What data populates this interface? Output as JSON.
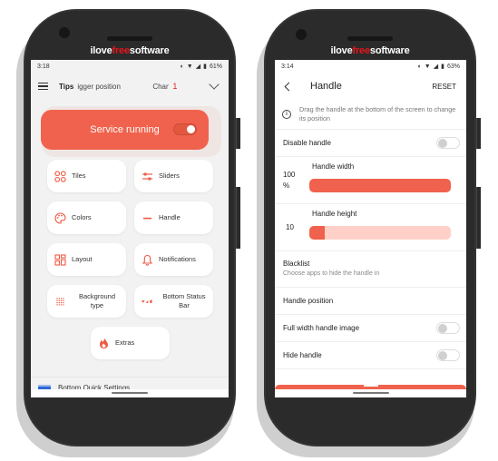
{
  "brand": {
    "prefix": "ilove",
    "highlight": "free",
    "suffix": "software"
  },
  "left_phone": {
    "status": {
      "time": "3:18",
      "battery": "61%"
    },
    "toolbar": {
      "tips_label": "Tips",
      "tip_text": "igger position",
      "chan_text": "Chan",
      "badge_count": "1"
    },
    "service": {
      "label": "Service running",
      "enabled": true
    },
    "tiles": [
      {
        "label": "Tiles",
        "icon": "tiles-icon"
      },
      {
        "label": "Sliders",
        "icon": "sliders-icon"
      },
      {
        "label": "Colors",
        "icon": "palette-icon"
      },
      {
        "label": "Handle",
        "icon": "handle-icon"
      },
      {
        "label": "Layout",
        "icon": "layout-icon"
      },
      {
        "label": "Notifications",
        "icon": "bell-icon"
      },
      {
        "label": "Background type",
        "icon": "background-pattern-icon"
      },
      {
        "label": "Bottom Status Bar",
        "icon": "status-bar-icon"
      },
      {
        "label": "Extras",
        "icon": "fire-icon"
      }
    ],
    "bottom_item": {
      "label": "Bottom Quick Settings"
    }
  },
  "right_phone": {
    "status": {
      "time": "3:14",
      "battery": "63%"
    },
    "toolbar": {
      "title": "Handle",
      "reset_label": "RESET"
    },
    "info_text": "Drag the handle at the bottom of the screen to change its position",
    "disable_handle": {
      "label": "Disable handle",
      "enabled": false
    },
    "handle_width": {
      "label": "Handle width",
      "value": "100",
      "unit": "%",
      "fill_percent": 100
    },
    "handle_height": {
      "label": "Handle height",
      "value": "10",
      "fill_percent": 11
    },
    "blacklist": {
      "title": "Blacklist",
      "subtitle": "Choose apps to hide the handle in"
    },
    "handle_position": {
      "label": "Handle position"
    },
    "full_width_image": {
      "label": "Full width handle image",
      "enabled": false
    },
    "hide_handle": {
      "label": "Hide handle",
      "enabled": false
    }
  },
  "colors": {
    "accent": "#f0624d",
    "accent_light": "#ffd0c7",
    "frame": "#2b2b2b",
    "brand_red": "#e8141c"
  }
}
